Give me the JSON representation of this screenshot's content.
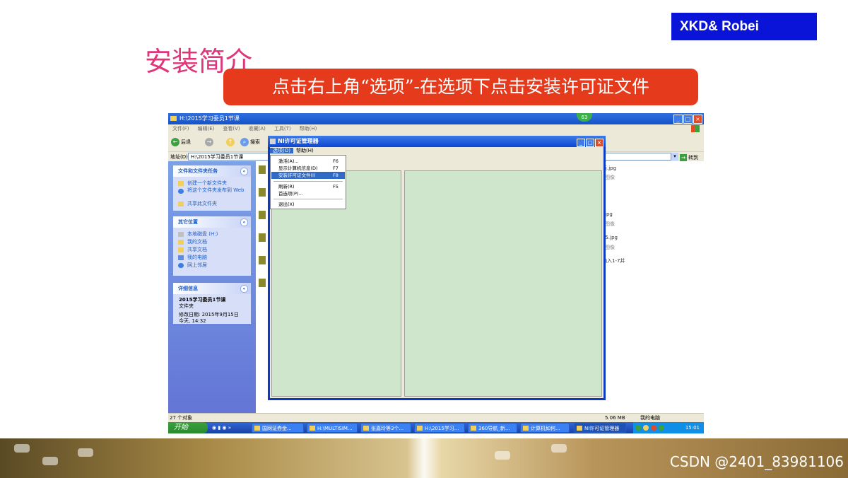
{
  "brand": "XKD& Robei",
  "title": "安装简介",
  "banner": "点击右上角“选项”-在选项下点击安装许可证文件",
  "explorer": {
    "window_title": "H:\\2015学习委员1节课",
    "badge": "63",
    "menu": [
      "文件(F)",
      "编辑(E)",
      "查看(V)",
      "收藏(A)",
      "工具(T)",
      "帮助(H)"
    ],
    "back_label": "后退",
    "search_label": "搜索",
    "address_label": "地址(D)",
    "address_value": "H:\\2015学习委员1节课",
    "go_label": "转到",
    "tasks": {
      "header": "文件和文件夹任务",
      "items": [
        "创建一个新文件夹",
        "将这个文件夹发布到 Web",
        "共享此文件夹"
      ]
    },
    "places": {
      "header": "其它位置",
      "items": [
        "本地磁盘 (H:)",
        "我的文档",
        "共享文档",
        "我的电脑",
        "网上邻居"
      ]
    },
    "details": {
      "header": "详细信息",
      "name": "2015学习委员1节课",
      "type": "文件夹",
      "modified_label": "修改日期: 2015年9月15日",
      "modified_time": "今天, 14:32"
    },
    "file_snippets": [
      "表.jpg",
      "图像",
      "jpg",
      "图像",
      "15.jpg",
      "图像",
      "输入1-7并"
    ],
    "status_left": "27 个对象",
    "status_size": "5.06 MB",
    "status_location": "我的电脑"
  },
  "taskbar": {
    "start": "开始",
    "buttons": [
      "国网证券金...",
      "H:\\MULTISIM...",
      "张嘉玲等3个...",
      "H:\\2015学习...",
      "360导航_新...",
      "计算机如何...",
      "NI许可证管理器"
    ],
    "clock": "15:01"
  },
  "dialog": {
    "title": "NI许可证管理器",
    "menu": [
      "选项(O)",
      "帮助(H)"
    ],
    "options_menu": [
      {
        "label": "激活(A)...",
        "key": "F6"
      },
      {
        "label": "显示计算机信息(D)",
        "key": "F7"
      },
      {
        "label": "安装许可证文件(I)",
        "key": "F8"
      },
      {
        "label": "刷新(R)",
        "key": "F5"
      },
      {
        "label": "首选项(P)...",
        "key": ""
      },
      {
        "label": "退出(X)",
        "key": ""
      }
    ]
  },
  "watermark": "CSDN @2401_83981106"
}
